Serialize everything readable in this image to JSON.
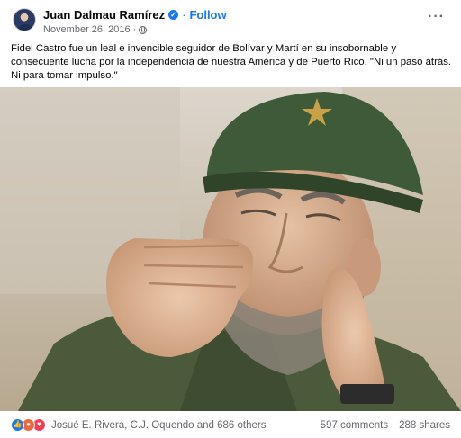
{
  "post": {
    "author": "Juan Dalmau Ramírez",
    "follow_label": "Follow",
    "separator": "·",
    "date": "November 26, 2016",
    "audience_icon": "globe-icon",
    "more_icon": "more-options-icon",
    "caption": "Fidel Castro fue un leal e invencible seguidor de Bolívar y Martí en su insobornable y consecuente lucha por la independencia de nuestra América y de Puerto Rico. \"Ni un paso atrás. Ni para tomar impulso.\""
  },
  "reactions": {
    "icons": [
      "like-reaction-icon",
      "angry-reaction-icon",
      "love-reaction-icon"
    ],
    "names_text": "Josué E. Rivera, C.J. Oquendo and 686 others",
    "comments": "597 comments",
    "shares": "288 shares"
  },
  "colors": {
    "accent": "#1877f2",
    "secondary_text": "#65676b",
    "cap_green": "#3f5a38"
  }
}
